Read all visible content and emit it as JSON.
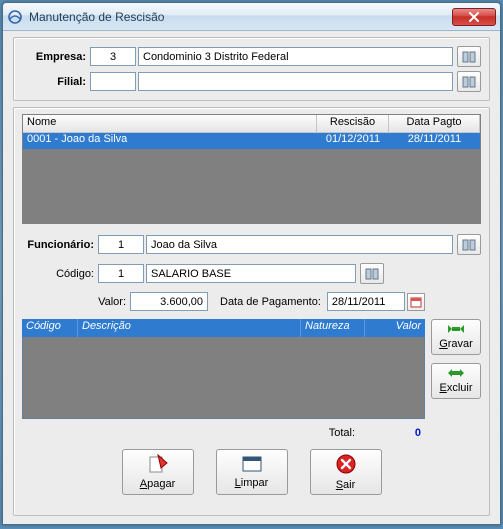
{
  "window": {
    "title": "Manutenção de Rescisão"
  },
  "header": {
    "empresa_label": "Empresa:",
    "empresa_code": "3",
    "empresa_name": "Condominio 3 Distrito Federal",
    "filial_label": "Filial:",
    "filial_code": "",
    "filial_name": ""
  },
  "grid1": {
    "columns": {
      "nome": "Nome",
      "rescisao": "Rescisão",
      "data_pagto": "Data Pagto"
    },
    "rows": [
      {
        "nome": "0001 - Joao da Silva",
        "rescisao": "01/12/2011",
        "data_pagto": "28/11/2011"
      }
    ]
  },
  "form": {
    "funcionario_label": "Funcionário:",
    "funcionario_code": "1",
    "funcionario_name": "Joao da Silva",
    "codigo_label": "Código:",
    "codigo_code": "1",
    "codigo_name": "SALARIO BASE",
    "valor_label": "Valor:",
    "valor": "3.600,00",
    "data_pag_label": "Data de Pagamento:",
    "data_pag": "28/11/2011"
  },
  "grid2": {
    "columns": {
      "codigo": "Código",
      "descricao": "Descrição",
      "natureza": "Natureza",
      "valor": "Valor"
    }
  },
  "side": {
    "gravar": "Gravar",
    "excluir": "Excluir"
  },
  "totals": {
    "label": "Total:",
    "value": "0"
  },
  "buttons": {
    "apagar": "Apagar",
    "limpar": "Limpar",
    "sair": "Sair"
  }
}
